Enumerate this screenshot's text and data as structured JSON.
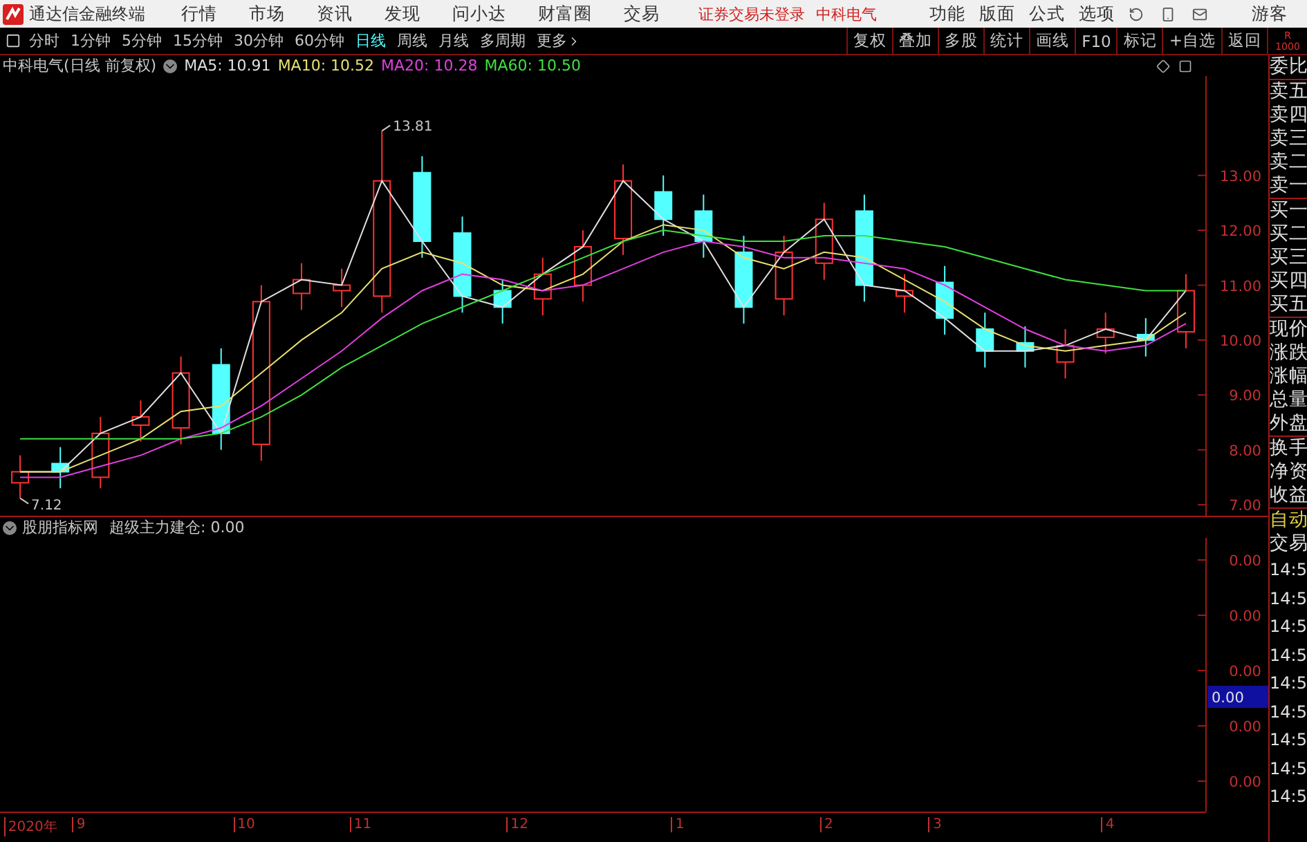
{
  "title_bar": {
    "app_name": "通达信金融终端",
    "menus": [
      "行情",
      "市场",
      "资讯",
      "发现",
      "问小达",
      "财富圈",
      "交易"
    ],
    "status": [
      "证券交易未登录",
      "中科电气"
    ],
    "right_menus": [
      "功能",
      "版面",
      "公式",
      "选项"
    ],
    "user": "游客"
  },
  "toolbar": {
    "periods": [
      {
        "label": "分时",
        "selected": false
      },
      {
        "label": "1分钟",
        "selected": false
      },
      {
        "label": "5分钟",
        "selected": false
      },
      {
        "label": "15分钟",
        "selected": false
      },
      {
        "label": "30分钟",
        "selected": false
      },
      {
        "label": "60分钟",
        "selected": false
      },
      {
        "label": "日线",
        "selected": true
      },
      {
        "label": "周线",
        "selected": false
      },
      {
        "label": "月线",
        "selected": false
      },
      {
        "label": "多周期",
        "selected": false
      }
    ],
    "more": "更多",
    "buttons": [
      "复权",
      "叠加",
      "多股",
      "统计",
      "画线",
      "F10",
      "标记",
      "+自选",
      "返回"
    ],
    "corner": [
      "R",
      "1000"
    ]
  },
  "chart_header": {
    "title": "中科电气(日线 前复权)",
    "indicators": [
      {
        "label": "MA5: 10.91",
        "color": "#e0e0e0"
      },
      {
        "label": "MA10: 10.52",
        "color": "#e8e070"
      },
      {
        "label": "MA20: 10.28",
        "color": "#e040e0"
      },
      {
        "label": "MA60: 10.50",
        "color": "#40e040"
      }
    ]
  },
  "price_chart": {
    "chart_data": {
      "type": "candlestick",
      "ohlc": [
        [
          7.4,
          7.9,
          7.12,
          7.6
        ],
        [
          7.75,
          8.05,
          7.3,
          7.6
        ],
        [
          7.5,
          8.6,
          7.3,
          8.3
        ],
        [
          8.45,
          8.9,
          8.15,
          8.6
        ],
        [
          8.4,
          9.7,
          8.1,
          9.4
        ],
        [
          9.55,
          9.85,
          8.0,
          8.3
        ],
        [
          8.1,
          11.0,
          7.8,
          10.7
        ],
        [
          10.85,
          11.4,
          10.55,
          11.1
        ],
        [
          10.9,
          11.3,
          10.6,
          11.0
        ],
        [
          10.8,
          13.81,
          10.5,
          12.9
        ],
        [
          13.05,
          13.35,
          11.5,
          11.8
        ],
        [
          11.95,
          12.25,
          10.5,
          10.8
        ],
        [
          10.9,
          11.1,
          10.3,
          10.6
        ],
        [
          10.75,
          11.5,
          10.45,
          11.2
        ],
        [
          11.0,
          12.0,
          10.7,
          11.7
        ],
        [
          11.85,
          13.2,
          11.55,
          12.9
        ],
        [
          12.7,
          13.0,
          11.9,
          12.2
        ],
        [
          12.35,
          12.65,
          11.5,
          11.8
        ],
        [
          11.6,
          11.9,
          10.3,
          10.6
        ],
        [
          10.75,
          11.9,
          10.45,
          11.6
        ],
        [
          11.4,
          12.5,
          11.1,
          12.2
        ],
        [
          12.35,
          12.65,
          10.7,
          11.0
        ],
        [
          10.8,
          11.2,
          10.5,
          10.9
        ],
        [
          11.05,
          11.35,
          10.1,
          10.4
        ],
        [
          10.2,
          10.5,
          9.5,
          9.8
        ],
        [
          9.95,
          10.25,
          9.5,
          9.8
        ],
        [
          9.6,
          10.2,
          9.3,
          9.9
        ],
        [
          10.05,
          10.5,
          9.75,
          10.2
        ],
        [
          10.1,
          10.4,
          9.7,
          10.0
        ],
        [
          10.15,
          11.2,
          9.85,
          10.9
        ]
      ],
      "categories": [
        null,
        null,
        null,
        null,
        null,
        null,
        null,
        null,
        null,
        null,
        null,
        null,
        null,
        null,
        null,
        null,
        null,
        null,
        null,
        null,
        null,
        null,
        null,
        null,
        null,
        null,
        null,
        null,
        null,
        null
      ],
      "ylim": [
        6.8,
        14.81
      ],
      "yticks": [
        {
          "value": 7,
          "label": "7.00"
        },
        {
          "value": 8,
          "label": "8.00"
        },
        {
          "value": 9,
          "label": "9.00"
        },
        {
          "value": 10,
          "label": "10.00"
        },
        {
          "value": 11,
          "label": "11.00"
        },
        {
          "value": 12,
          "label": "12.00"
        },
        {
          "value": 13,
          "label": "13.00"
        }
      ],
      "series": [
        {
          "type": "line",
          "color": "#e0e0e0",
          "values": [
            7.6,
            7.6,
            8.3,
            8.6,
            9.4,
            8.3,
            10.7,
            11.1,
            11.0,
            12.9,
            11.8,
            10.8,
            10.6,
            11.2,
            11.7,
            12.9,
            12.2,
            11.8,
            10.6,
            11.6,
            12.2,
            11.0,
            10.9,
            10.4,
            9.8,
            9.8,
            9.9,
            10.2,
            10.0,
            10.9
          ]
        },
        {
          "type": "line",
          "color": "#e8e070",
          "values": [
            7.6,
            7.6,
            7.9,
            8.2,
            8.7,
            8.8,
            9.4,
            10.0,
            10.5,
            11.3,
            11.6,
            11.4,
            11.0,
            10.9,
            11.2,
            11.8,
            12.1,
            12.0,
            11.5,
            11.3,
            11.6,
            11.5,
            11.1,
            10.7,
            10.2,
            9.9,
            9.8,
            9.9,
            10.0,
            10.5
          ]
        },
        {
          "type": "line",
          "color": "#e040e0",
          "values": [
            7.5,
            7.5,
            7.7,
            7.9,
            8.2,
            8.4,
            8.8,
            9.3,
            9.8,
            10.4,
            10.9,
            11.2,
            11.1,
            10.9,
            11.0,
            11.3,
            11.6,
            11.8,
            11.7,
            11.5,
            11.5,
            11.4,
            11.3,
            11.0,
            10.6,
            10.2,
            9.9,
            9.8,
            9.9,
            10.3
          ]
        },
        {
          "type": "line",
          "color": "#40e040",
          "values": [
            8.2,
            8.2,
            8.2,
            8.2,
            8.2,
            8.3,
            8.6,
            9.0,
            9.5,
            9.9,
            10.3,
            10.6,
            10.9,
            11.2,
            11.5,
            11.8,
            12.0,
            11.9,
            11.8,
            11.8,
            11.9,
            11.9,
            11.8,
            11.7,
            11.5,
            11.3,
            11.1,
            11.0,
            10.9,
            10.9
          ]
        }
      ],
      "annotations": [
        {
          "text": "13.81"
        },
        {
          "text": "7.12"
        }
      ]
    },
    "date_axis": [
      "2020年",
      "9",
      "10",
      "11",
      "12",
      "1",
      "2",
      "3",
      "4"
    ]
  },
  "indicator": {
    "source": "股朋指标网",
    "label": "超级主力建仓: 0.00",
    "axis_labels": [
      "0.00",
      "0.00",
      "0.00",
      "0.00",
      "0.00"
    ],
    "readout": "0.00"
  },
  "right_panel": {
    "quote_groups": [
      [
        "委比"
      ],
      [
        "卖五",
        "卖四",
        "卖三",
        "卖二",
        "卖一"
      ],
      [
        "买一",
        "买二",
        "买三",
        "买四",
        "买五"
      ],
      [
        "现价",
        "涨跌",
        "涨幅",
        "总量",
        "外盘"
      ],
      [
        "换手",
        "净资",
        "收益"
      ]
    ],
    "trade_mode": "自动",
    "trade_label": "交易",
    "times": [
      "14:5",
      "14:5",
      "14:5",
      "14:5",
      "14:5",
      "14:5",
      "14:5",
      "14:5",
      "14:5"
    ]
  }
}
